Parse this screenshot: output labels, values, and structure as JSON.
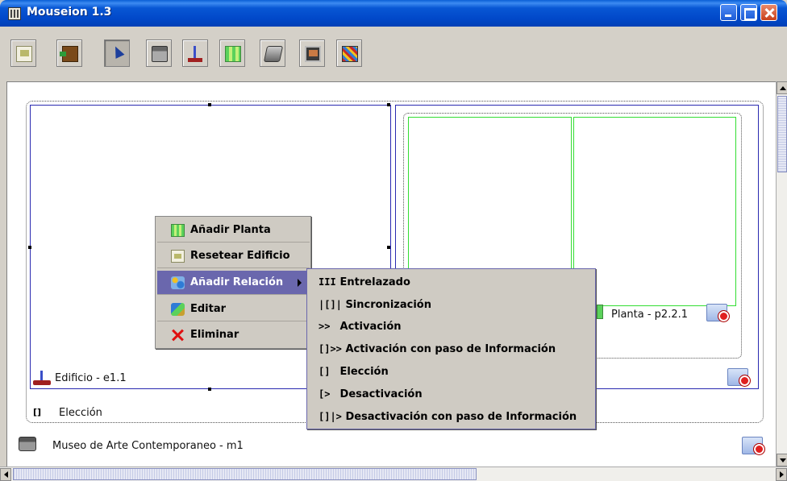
{
  "window": {
    "title": "Mouseion 1.3"
  },
  "toolbar": {
    "buttons": [
      {
        "icon": "page-edit-icon"
      },
      {
        "icon": "exit-door-icon"
      },
      {
        "icon": "select-cursor-icon"
      },
      {
        "icon": "museum-building-icon"
      },
      {
        "icon": "building-icon"
      },
      {
        "icon": "floor-plan-icon"
      },
      {
        "icon": "room-box-icon"
      },
      {
        "icon": "artwork-icon"
      },
      {
        "icon": "relation-icon"
      }
    ]
  },
  "diagram": {
    "museo_label": "Museo de Arte Contemporaneo - m1",
    "edificio_label": "Edificio  - e1.1",
    "planta_label": "Planta  - p2.2.1",
    "eleccion_symbol": "[]",
    "eleccion_label": "Elección"
  },
  "context_menu": {
    "items": [
      {
        "label": "Añadir Planta",
        "icon": "add-floor-icon"
      },
      {
        "label": "Resetear Edificio",
        "icon": "reset-icon"
      },
      {
        "label": "Añadir Relación",
        "icon": "add-relation-icon",
        "active": true
      },
      {
        "label": "Editar",
        "icon": "edit-icon"
      },
      {
        "label": "Eliminar",
        "icon": "delete-x-icon"
      }
    ]
  },
  "submenu": {
    "items": [
      {
        "symbol": "III",
        "label": "Entrelazado"
      },
      {
        "symbol": "|[]|",
        "label": "Sincronización"
      },
      {
        "symbol": ">>",
        "label": "Activación"
      },
      {
        "symbol": "[]>>",
        "label": "Activación con paso de Información"
      },
      {
        "symbol": "[]",
        "label": "Elección"
      },
      {
        "symbol": "[>",
        "label": "Desactivación"
      },
      {
        "symbol": "[]|>",
        "label": "Desactivación con paso de Información"
      }
    ]
  },
  "colors": {
    "titlebar": "#0148c9",
    "menu_highlight": "#6a67ad",
    "room_border": "#33dd33",
    "building_border": "#2a2ab0"
  }
}
